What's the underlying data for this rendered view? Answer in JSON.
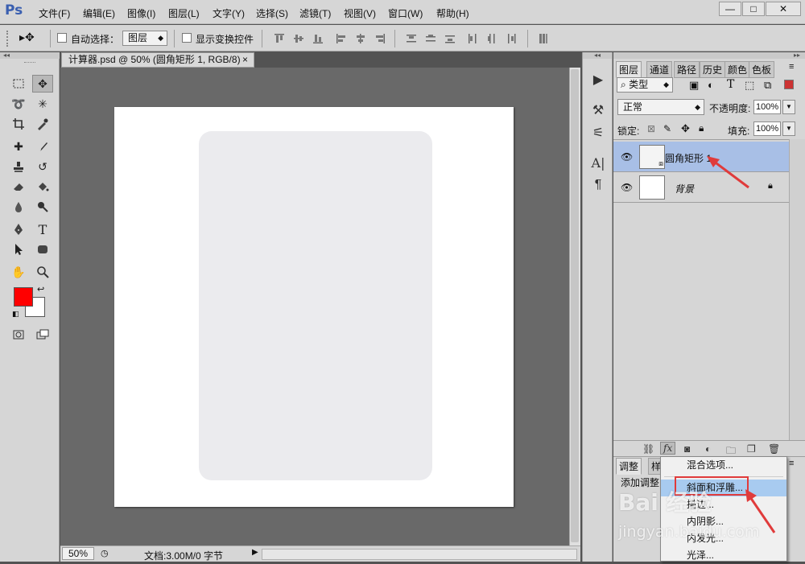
{
  "app": {
    "logo": "Ps"
  },
  "menu": [
    "文件(F)",
    "编辑(E)",
    "图像(I)",
    "图层(L)",
    "文字(Y)",
    "选择(S)",
    "滤镜(T)",
    "视图(V)",
    "窗口(W)",
    "帮助(H)"
  ],
  "window_buttons": {
    "minimize": "—",
    "restore": "□",
    "close": "✕"
  },
  "options": {
    "auto_select_label": "自动选择：",
    "auto_select_value": "图层",
    "show_transform_label": "显示变换控件"
  },
  "document": {
    "tab_title": "计算器.psd @ 50% (圆角矩形 1, RGB/8)",
    "tab_close": "×",
    "zoom": "50%",
    "doc_info": "文档:3.00M/0 字节"
  },
  "panel": {
    "tabs": [
      "图层",
      "通道",
      "路径",
      "历史",
      "颜色",
      "色板"
    ],
    "kind_filter": "类型",
    "blend_mode": "正常",
    "opacity_label": "不透明度:",
    "opacity_value": "100%",
    "lock_label": "锁定:",
    "fill_label": "填充:",
    "fill_value": "100%",
    "layers": [
      {
        "name": "圆角矩形 1",
        "selected": true
      },
      {
        "name": "背景",
        "selected": false,
        "locked": true
      }
    ],
    "bottom_tabs": [
      "调整",
      "样"
    ],
    "adjust_text": "添加调整"
  },
  "context_menu": {
    "items": [
      "混合选项...",
      "斜面和浮雕...",
      "描边...",
      "内阴影...",
      "内发光...",
      "光泽..."
    ],
    "highlighted_index": 1
  },
  "watermark": {
    "text": "Bai 经验",
    "url": "jingyan.baidu.com"
  },
  "colors": {
    "foreground": "#ff0000",
    "background": "#ffffff",
    "highlight": "#e03b3b",
    "selected_layer": "#a8bfe6"
  }
}
